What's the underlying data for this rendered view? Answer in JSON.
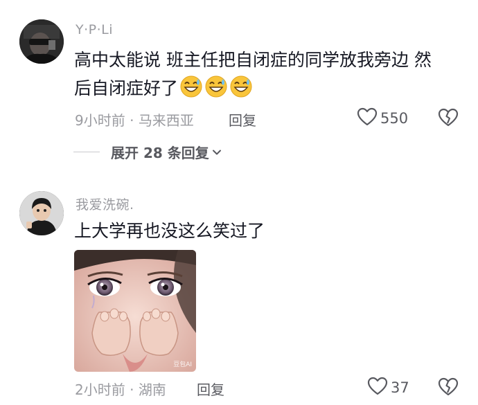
{
  "comments": [
    {
      "username": "Y·P·Li",
      "text": "高中太能说 班主任把自闭症的同学放我旁边 然后自闭症好了",
      "emoji": [
        "sweat-grin-emoji",
        "sweat-grin-emoji",
        "sweat-grin-emoji"
      ],
      "time": "9小时前",
      "location": "马来西亚",
      "reply_label": "回复",
      "likes": "550",
      "expand_label": "展开 28 条回复"
    },
    {
      "username": "我爱洗碗.",
      "text": "上大学再也没这么笑过了",
      "image_watermark": "豆包AI",
      "time": "2小时前",
      "location": "湖南",
      "reply_label": "回复",
      "likes": "37"
    }
  ],
  "meta_separator": " · ",
  "colors": {
    "text": "#161823",
    "secondary": "#9a9ba0",
    "icon": "#58595f"
  }
}
